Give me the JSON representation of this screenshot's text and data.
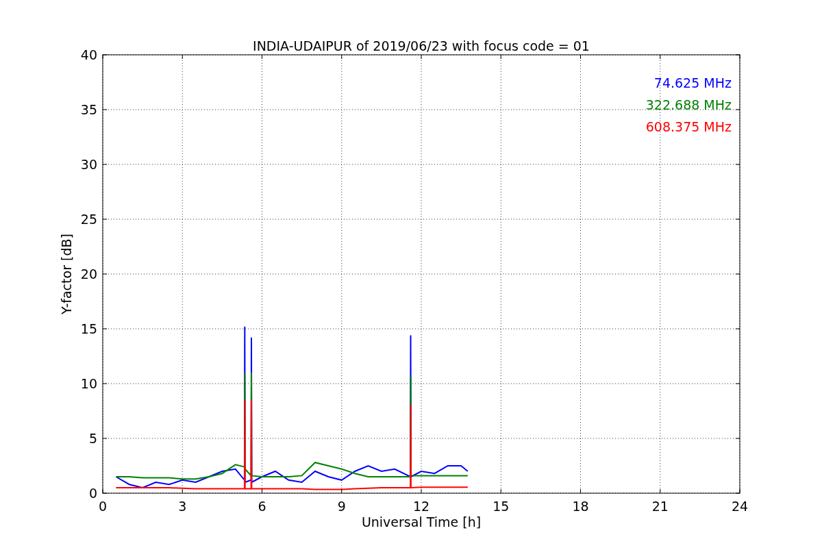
{
  "chart_data": {
    "type": "line",
    "title": "INDIA-UDAIPUR of 2019/06/23 with focus code = 01",
    "xlabel": "Universal Time [h]",
    "ylabel": "Y-factor [dB]",
    "x": [
      0.5,
      1,
      1.5,
      2,
      2.5,
      3,
      3.5,
      4,
      4.5,
      5,
      5.34,
      5.35,
      5.36,
      5.59,
      5.6,
      5.61,
      6,
      6.5,
      7,
      7.5,
      8,
      8.5,
      9,
      9.5,
      10,
      10.5,
      11,
      11.59,
      11.6,
      11.61,
      12,
      12.5,
      13,
      13.5,
      13.75
    ],
    "series": [
      {
        "name": "74.625 MHz",
        "color": "#0000ff",
        "values": [
          1.5,
          0.8,
          0.5,
          1,
          0.8,
          1.2,
          1,
          1.5,
          2,
          2.2,
          1.2,
          15.2,
          1,
          1.2,
          14.2,
          1,
          1.5,
          2,
          1.2,
          1,
          2,
          1.5,
          1.2,
          2,
          2.5,
          2,
          2.2,
          1.5,
          14.4,
          1.5,
          2,
          1.8,
          2.5,
          2.5,
          2
        ]
      },
      {
        "name": "322.688 MHz",
        "color": "#008000",
        "values": [
          1.5,
          1.5,
          1.4,
          1.4,
          1.4,
          1.3,
          1.3,
          1.5,
          1.8,
          2.6,
          2.4,
          11,
          2.2,
          1.6,
          11,
          1.6,
          1.5,
          1.5,
          1.5,
          1.6,
          2.8,
          2.5,
          2.2,
          1.8,
          1.5,
          1.5,
          1.5,
          1.5,
          10.7,
          1.6,
          1.6,
          1.6,
          1.6,
          1.6,
          1.6
        ]
      },
      {
        "name": "608.375 MHz",
        "color": "#ff0000",
        "values": [
          0.5,
          0.5,
          0.5,
          0.5,
          0.5,
          0.45,
          0.4,
          0.4,
          0.4,
          0.4,
          0.4,
          8.5,
          0.4,
          0.4,
          8.5,
          0.4,
          0.4,
          0.4,
          0.4,
          0.4,
          0.35,
          0.35,
          0.35,
          0.4,
          0.45,
          0.5,
          0.5,
          0.5,
          8.1,
          0.5,
          0.55,
          0.55,
          0.55,
          0.55,
          0.55
        ]
      }
    ],
    "xlim": [
      0,
      24
    ],
    "ylim": [
      0,
      40
    ],
    "xticks": [
      0,
      3,
      6,
      9,
      12,
      15,
      18,
      21,
      24
    ],
    "yticks": [
      0,
      5,
      10,
      15,
      20,
      25,
      30,
      35,
      40
    ],
    "grid": true
  }
}
